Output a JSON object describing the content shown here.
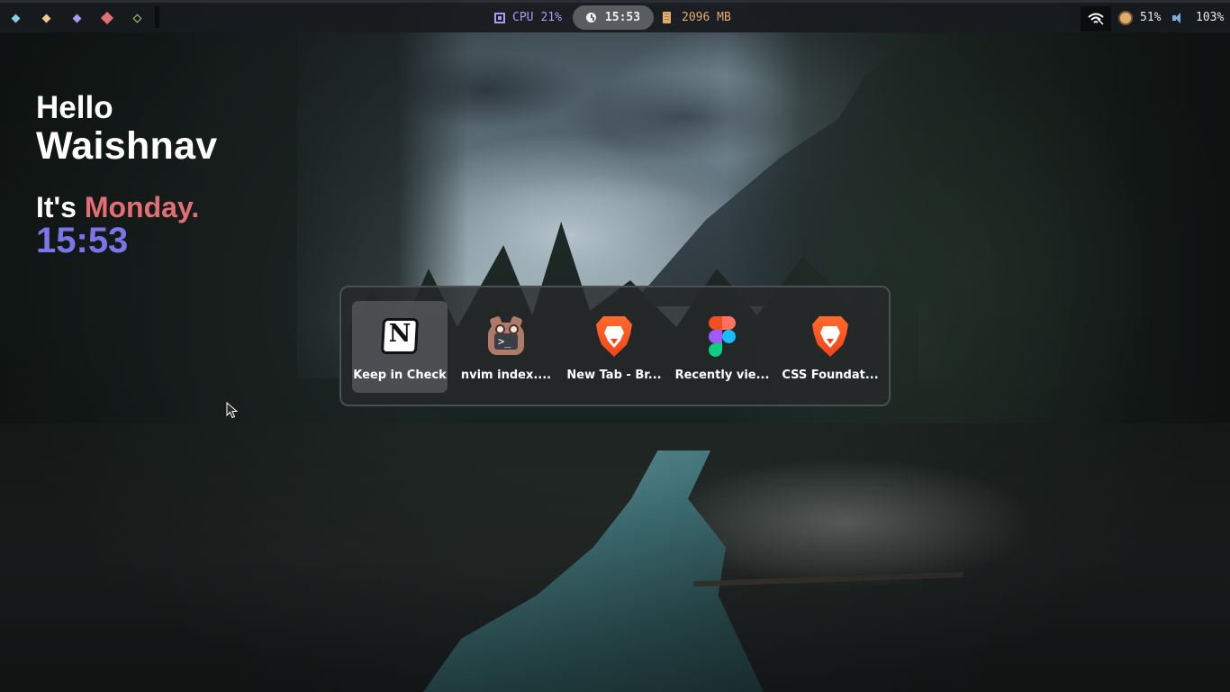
{
  "topbar": {
    "workspaces": [
      {
        "color": "#7fd3e0",
        "style": "filled-small"
      },
      {
        "color": "#f4c98a",
        "style": "filled-small"
      },
      {
        "color": "#a99cf0",
        "style": "filled-small"
      },
      {
        "color": "#e36e73",
        "style": "filled-large"
      },
      {
        "color": "#9fd67a",
        "style": "outline-small"
      }
    ],
    "cpu_label": "CPU",
    "cpu_value": "21%",
    "clock": "15:53",
    "memory": "2096 MB",
    "brightness": "51%",
    "volume": "103%",
    "colors": {
      "cpu": "#a99cf0",
      "memory": "#e2ad6a",
      "brightness": "#e2ad6a",
      "volume": "#7da9e6"
    }
  },
  "greeting": {
    "hello": "Hello",
    "name": "Waishnav",
    "its": "It's",
    "day": "Monday.",
    "time": "15:53",
    "colors": {
      "day": "#e36e73",
      "time": "#7b75ea"
    }
  },
  "switcher": {
    "apps": [
      {
        "label": "Keep in Check",
        "icon": "notion-icon",
        "selected": true
      },
      {
        "label": "nvim index....",
        "icon": "terminal-owl-icon",
        "selected": false
      },
      {
        "label": "New Tab - Br...",
        "icon": "brave-icon",
        "selected": false
      },
      {
        "label": "Recently vie...",
        "icon": "figma-icon",
        "selected": false
      },
      {
        "label": "CSS Foundat...",
        "icon": "brave-icon",
        "selected": false
      }
    ]
  }
}
